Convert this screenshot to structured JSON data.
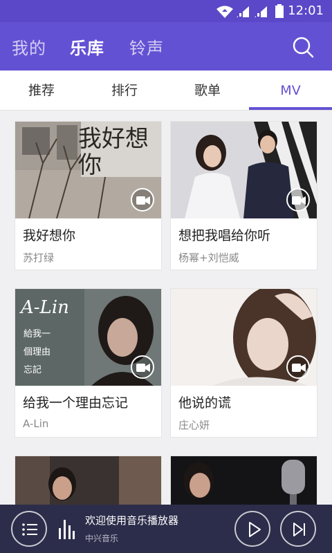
{
  "status_bar": {
    "time": "12:01"
  },
  "header": {
    "tabs": [
      {
        "label": "我的",
        "active": false
      },
      {
        "label": "乐库",
        "active": true
      },
      {
        "label": "铃声",
        "active": false
      }
    ],
    "search_icon": "search-icon"
  },
  "subtabs": [
    {
      "label": "推荐",
      "active": false
    },
    {
      "label": "排行",
      "active": false
    },
    {
      "label": "歌单",
      "active": false
    },
    {
      "label": "MV",
      "active": true
    }
  ],
  "mv_list": [
    {
      "title": "我好想你",
      "artist": "苏打绿",
      "overlay": "我好想你"
    },
    {
      "title": "想把我唱给你听",
      "artist": "杨幂+刘恺威"
    },
    {
      "title": "给我一个理由忘记",
      "artist": "A-Lin",
      "overlay": "A-Lin",
      "overlay_lines": [
        "給我一",
        "個理由",
        "忘記"
      ]
    },
    {
      "title": "他说的谎",
      "artist": "庄心妍"
    },
    {
      "title": "",
      "artist": ""
    },
    {
      "title": "",
      "artist": ""
    }
  ],
  "player": {
    "title": "欢迎使用音乐播放器",
    "subtitle": "中兴音乐",
    "icons": [
      "playlist-icon",
      "equalizer-icon",
      "play-icon",
      "next-icon"
    ]
  },
  "colors": {
    "accent": "#6351d4",
    "status_bar": "#5a48c8",
    "player_bg": "#2c2d4a"
  }
}
